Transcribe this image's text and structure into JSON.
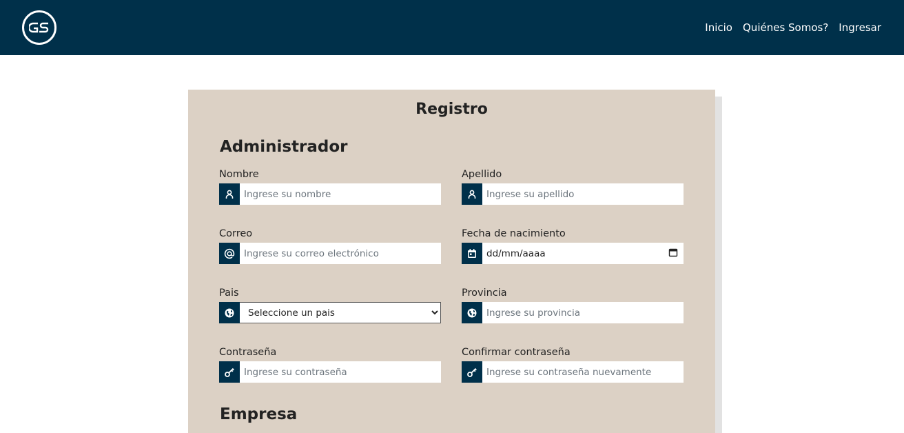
{
  "navbar": {
    "logo_text": "GS",
    "links": [
      "Inicio",
      "Quiénes Somos?",
      "Ingresar"
    ]
  },
  "form": {
    "title": "Registro",
    "section_admin": "Administrador",
    "section_company": "Empresa",
    "fields": {
      "nombre": {
        "label": "Nombre",
        "placeholder": "Ingrese su nombre",
        "icon": "user-icon"
      },
      "apellido": {
        "label": "Apellido",
        "placeholder": "Ingrese su apellido",
        "icon": "user-icon"
      },
      "correo": {
        "label": "Correo",
        "placeholder": "Ingrese su correo electrónico",
        "icon": "at-icon"
      },
      "fecha": {
        "label": "Fecha de nacimiento",
        "value": "dd/mm/aaaa",
        "icon": "calendar-icon"
      },
      "pais": {
        "label": "Pais",
        "selected": "Seleccione un pais",
        "icon": "globe-icon"
      },
      "provincia": {
        "label": "Provincia",
        "placeholder": "Ingrese su provincia",
        "icon": "globe-icon"
      },
      "contrasena": {
        "label": "Contraseña",
        "placeholder": "Ingrese su contraseña",
        "icon": "key-icon"
      },
      "confirmar": {
        "label": "Confirmar contraseña",
        "placeholder": "Ingrese su contraseña nuevamente",
        "icon": "key-icon"
      }
    }
  },
  "colors": {
    "navbar": "#00304a",
    "card": "#dcd1c5",
    "icon_bg": "#00304a"
  }
}
